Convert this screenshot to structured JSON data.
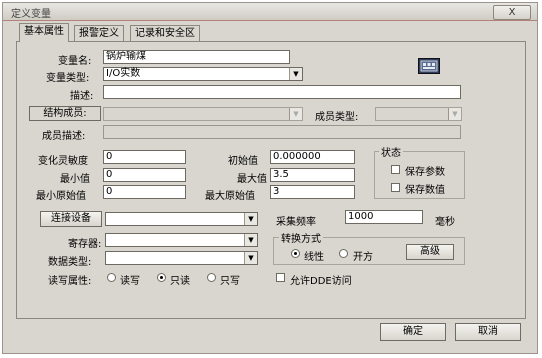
{
  "window": {
    "title": "定义变量",
    "close_label": "X"
  },
  "tabs": [
    {
      "label": "基本属性",
      "active": true
    },
    {
      "label": "报警定义",
      "active": false
    },
    {
      "label": "记录和安全区",
      "active": false
    }
  ],
  "fields": {
    "var_name_label": "变量名:",
    "var_name_value": "锅炉输煤",
    "var_type_label": "变量类型:",
    "var_type_value": "I/O实数",
    "desc_label": "描述:",
    "desc_value": "",
    "struct_member_label": "结构成员:",
    "member_type_label": "成员类型:",
    "member_desc_label": "成员描述:"
  },
  "numeric": {
    "sensitivity_label": "变化灵敏度",
    "sensitivity_value": "0",
    "min_label": "最小值",
    "min_value": "0",
    "min_raw_label": "最小原始值",
    "min_raw_value": "0",
    "init_label": "初始值",
    "init_value": "0.000000",
    "max_label": "最大值",
    "max_value": "3.5",
    "max_raw_label": "最大原始值",
    "max_raw_value": "3"
  },
  "status": {
    "title": "状态",
    "save_params": "保存参数",
    "save_values": "保存数值"
  },
  "io": {
    "connect_device_label": "连接设备",
    "register_label": "寄存器:",
    "data_type_label": "数据类型:",
    "rw_label": "读写属性:",
    "rw_options": [
      "读写",
      "只读",
      "只写"
    ],
    "rw_selected": "只读",
    "sample_label": "采集频率",
    "sample_value": "1000",
    "sample_unit": "毫秒"
  },
  "conversion": {
    "title": "转换方式",
    "linear": "线性",
    "sqrt": "开方",
    "selected": "线性",
    "advanced_label": "高级"
  },
  "allow_dde_label": "允许DDE访问",
  "buttons": {
    "ok": "确定",
    "cancel": "取消"
  }
}
